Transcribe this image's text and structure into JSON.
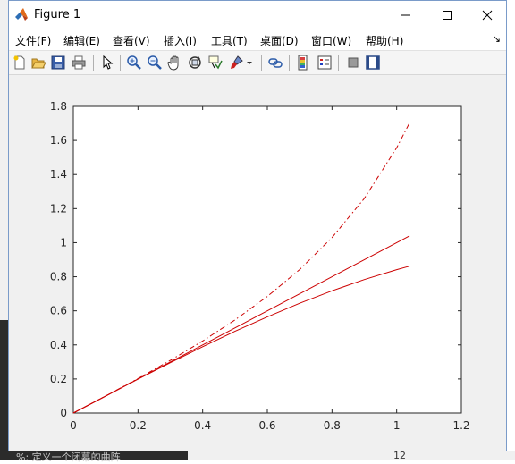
{
  "window": {
    "title": "Figure 1"
  },
  "menu": [
    "文件(F)",
    "编辑(E)",
    "查看(V)",
    "插入(I)",
    "工具(T)",
    "桌面(D)",
    "窗口(W)",
    "帮助(H)"
  ],
  "toolbar_icons": [
    "new-figure-icon",
    "open-file-icon",
    "save-icon",
    "print-icon",
    "select-arrow-icon",
    "zoom-in-icon",
    "zoom-out-icon",
    "pan-hand-icon",
    "rotate-3d-icon",
    "data-cursor-icon",
    "brush-icon",
    "link-plot-icon",
    "colorbar-icon",
    "legend-icon",
    "hide-plot-tools-icon",
    "show-plot-tools-icon"
  ],
  "background": {
    "bottom_text": "%: 定义一个闭幕的曲阵",
    "bottom_number": "12"
  },
  "chart_data": {
    "type": "line",
    "xlim": [
      0,
      1.2
    ],
    "ylim": [
      0,
      1.8
    ],
    "x_ticks": [
      "0",
      "0.2",
      "0.4",
      "0.6",
      "0.8",
      "1",
      "1.2"
    ],
    "y_ticks": [
      "0",
      "0.2",
      "0.4",
      "0.6",
      "0.8",
      "1",
      "1.2",
      "1.4",
      "1.6",
      "1.8"
    ],
    "color": "#cc0000",
    "grid": false,
    "series": [
      {
        "style": "solid",
        "x": [
          0,
          0.2,
          0.4,
          0.6,
          0.8,
          1.0,
          1.04
        ],
        "y": [
          0,
          0.2,
          0.4,
          0.6,
          0.8,
          1.0,
          1.04
        ]
      },
      {
        "style": "solid",
        "x": [
          0,
          0.1,
          0.2,
          0.3,
          0.4,
          0.5,
          0.6,
          0.7,
          0.8,
          0.9,
          1.0,
          1.04
        ],
        "y": [
          0,
          0.0998,
          0.1987,
          0.2955,
          0.3894,
          0.4794,
          0.5646,
          0.6442,
          0.7174,
          0.7833,
          0.8415,
          0.8624
        ]
      },
      {
        "style": "dash-dot",
        "x": [
          0,
          0.1,
          0.2,
          0.3,
          0.4,
          0.5,
          0.6,
          0.7,
          0.8,
          0.9,
          1.0,
          1.04
        ],
        "y": [
          0,
          0.1003,
          0.2027,
          0.3093,
          0.4228,
          0.5463,
          0.6841,
          0.8423,
          1.0296,
          1.2602,
          1.5574,
          1.7036
        ]
      }
    ]
  }
}
